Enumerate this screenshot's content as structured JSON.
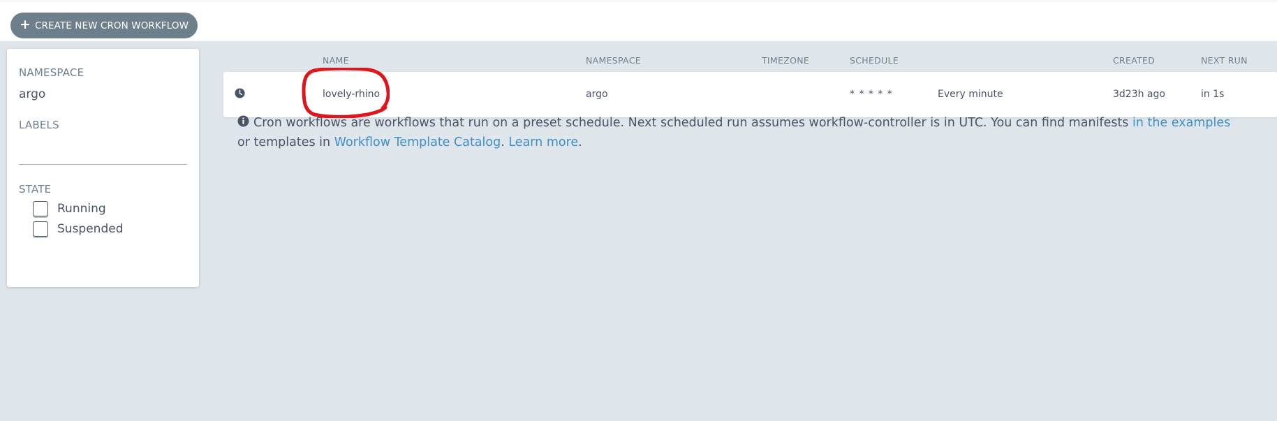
{
  "toolbar": {
    "create_label": "CREATE NEW CRON WORKFLOW",
    "create_icon": "plus-icon"
  },
  "filters": {
    "namespace_label": "NAMESPACE",
    "namespace_value": "argo",
    "labels_label": "LABELS",
    "labels_value": "",
    "state_label": "STATE",
    "states": [
      {
        "label": "Running",
        "checked": false
      },
      {
        "label": "Suspended",
        "checked": false
      }
    ]
  },
  "table": {
    "headers": {
      "name": "NAME",
      "namespace": "NAMESPACE",
      "timezone": "TIMEZONE",
      "schedule": "SCHEDULE",
      "created": "CREATED",
      "next_run": "NEXT RUN"
    },
    "rows": [
      {
        "icon": "clock-icon",
        "name": "lovely-rhino",
        "namespace": "argo",
        "timezone": "",
        "schedule": "* * * * *",
        "schedule_desc": "Every minute",
        "created": "3d23h ago",
        "next_run": "in 1s"
      }
    ]
  },
  "info": {
    "icon": "info-icon",
    "text_1": "Cron workflows are workflows that run on a preset schedule. Next scheduled run assumes workflow-controller is in UTC. You can find manifests ",
    "link_examples": "in the examples",
    "text_2": " or templates in ",
    "link_catalog": "Workflow Template Catalog",
    "text_3": ". ",
    "link_learn": "Learn more",
    "text_4": "."
  },
  "colors": {
    "button_bg": "#6d7f8b",
    "content_bg": "#dee6eb",
    "link": "#3f8ec4",
    "annotation": "#e0151c"
  }
}
